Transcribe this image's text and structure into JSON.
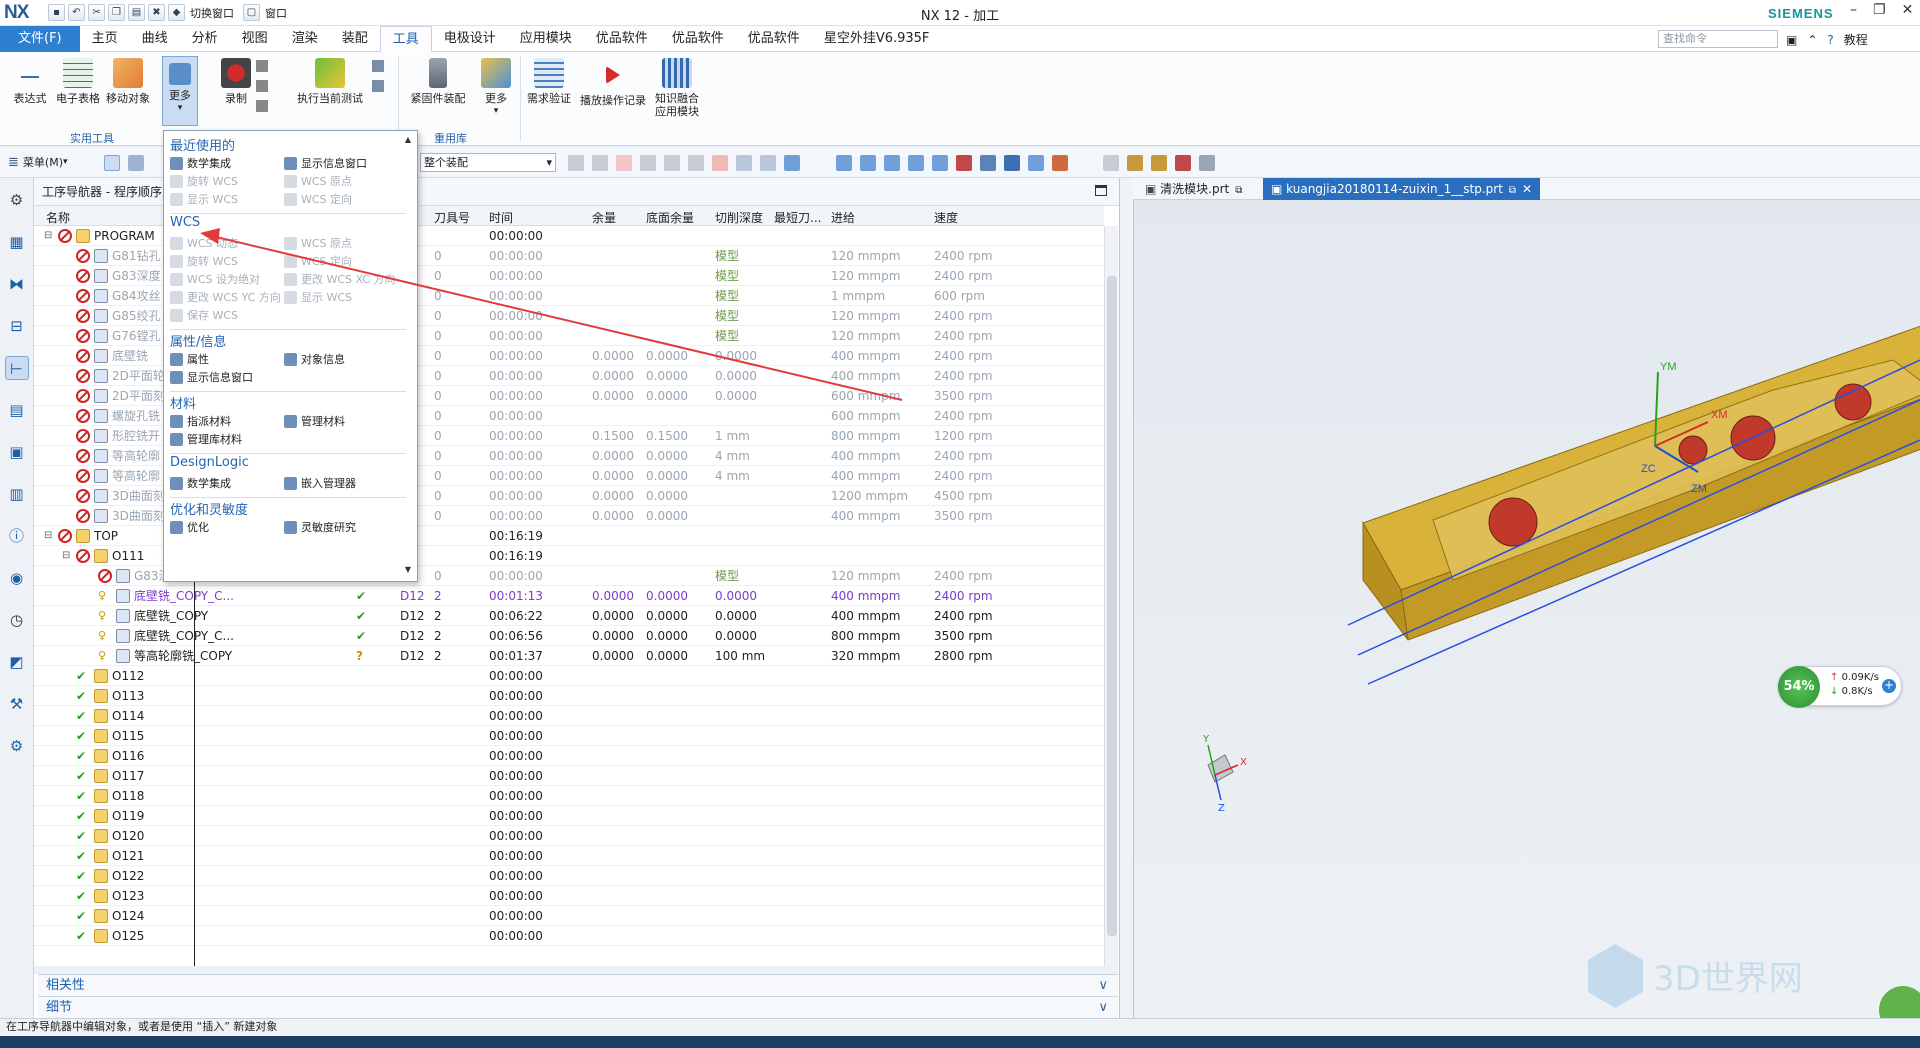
{
  "app": {
    "logo": "NX",
    "title": "NX 12 - 加工",
    "brand": "SIEMENS",
    "quick_access": [
      "切换窗口",
      "窗口"
    ]
  },
  "ribbon_tabs": [
    "文件(F)",
    "主页",
    "曲线",
    "分析",
    "视图",
    "渲染",
    "装配",
    "工具",
    "电极设计",
    "应用模块",
    "优品软件",
    "优品软件",
    "优品软件",
    "星空外挂V6.935F"
  ],
  "active_tab": "工具",
  "search_placeholder": "查找命令",
  "help_label": "教程",
  "ribbon": {
    "buttons": [
      "表达式",
      "电子表格",
      "移动对象",
      "更多",
      "录制",
      "执行当前测试",
      "紧固件装配",
      "更多",
      "需求验证",
      "播放操作记录",
      "知识融合应用模块"
    ],
    "groups": [
      "实用工具",
      "重用库"
    ]
  },
  "toolbar2": {
    "menu_label": "菜单(M)",
    "assembly_filter": "整个装配"
  },
  "navigator": {
    "title": "工序导航器 - 程序顺序",
    "columns": [
      "名称",
      "刀具号",
      "时间",
      "余量",
      "底面余量",
      "切削深度",
      "最短刀...",
      "进给",
      "速度"
    ],
    "rows": [
      {
        "name": "PROGRAM",
        "tool_no": "",
        "time": "00:00:00",
        "stock": "",
        "floor": "",
        "depth": "",
        "feed": "",
        "speed": "",
        "style": "",
        "level": 0
      },
      {
        "name": "G81钻孔",
        "tool_no": "0",
        "time": "00:00:00",
        "stock": "",
        "floor": "",
        "depth": "模型",
        "feed": "120 mmpm",
        "speed": "2400 rpm",
        "style": "gray",
        "level": 1
      },
      {
        "name": "G83深度",
        "tool_no": "0",
        "time": "00:00:00",
        "stock": "",
        "floor": "",
        "depth": "模型",
        "feed": "120 mmpm",
        "speed": "2400 rpm",
        "style": "gray",
        "level": 1
      },
      {
        "name": "G84攻丝",
        "tool_no": "0",
        "time": "00:00:00",
        "stock": "",
        "floor": "",
        "depth": "模型",
        "feed": "1 mmpm",
        "speed": "600 rpm",
        "style": "gray",
        "level": 1
      },
      {
        "name": "G85绞孔",
        "tool_no": "0",
        "time": "00:00:00",
        "stock": "",
        "floor": "",
        "depth": "模型",
        "feed": "120 mmpm",
        "speed": "2400 rpm",
        "style": "gray",
        "level": 1
      },
      {
        "name": "G76镗孔",
        "tool_no": "0",
        "time": "00:00:00",
        "stock": "",
        "floor": "",
        "depth": "模型",
        "feed": "120 mmpm",
        "speed": "2400 rpm",
        "style": "gray",
        "level": 1
      },
      {
        "name": "底壁铣",
        "tool_no": "0",
        "time": "00:00:00",
        "stock": "0.0000",
        "floor": "0.0000",
        "depth": "0.0000",
        "feed": "400 mmpm",
        "speed": "2400 rpm",
        "style": "gray",
        "level": 1
      },
      {
        "name": "2D平面轮",
        "tool_no": "0",
        "time": "00:00:00",
        "stock": "0.0000",
        "floor": "0.0000",
        "depth": "0.0000",
        "feed": "400 mmpm",
        "speed": "2400 rpm",
        "style": "gray",
        "level": 1
      },
      {
        "name": "2D平面刻",
        "tool_no": "0",
        "time": "00:00:00",
        "stock": "0.0000",
        "floor": "0.0000",
        "depth": "0.0000",
        "feed": "600 mmpm",
        "speed": "3500 rpm",
        "style": "gray",
        "level": 1
      },
      {
        "name": "螺旋孔铣",
        "tool_no": "0",
        "time": "00:00:00",
        "stock": "",
        "floor": "",
        "depth": "",
        "feed": "600 mmpm",
        "speed": "2400 rpm",
        "style": "gray",
        "level": 1
      },
      {
        "name": "形腔铣开",
        "tool_no": "0",
        "time": "00:00:00",
        "stock": "0.1500",
        "floor": "0.1500",
        "depth": "1 mm",
        "feed": "800 mmpm",
        "speed": "1200 rpm",
        "style": "gray",
        "level": 1
      },
      {
        "name": "等高轮廓",
        "tool_no": "0",
        "time": "00:00:00",
        "stock": "0.0000",
        "floor": "0.0000",
        "depth": "4 mm",
        "feed": "400 mmpm",
        "speed": "2400 rpm",
        "style": "gray",
        "level": 1
      },
      {
        "name": "等高轮廓",
        "tool_no": "0",
        "time": "00:00:00",
        "stock": "0.0000",
        "floor": "0.0000",
        "depth": "4 mm",
        "feed": "400 mmpm",
        "speed": "2400 rpm",
        "style": "gray",
        "level": 1
      },
      {
        "name": "3D曲面刻",
        "tool_no": "0",
        "time": "00:00:00",
        "stock": "0.0000",
        "floor": "0.0000",
        "depth": "",
        "feed": "1200 mmpm",
        "speed": "4500 rpm",
        "style": "gray",
        "level": 1
      },
      {
        "name": "3D曲面刻",
        "tool_no": "0",
        "time": "00:00:00",
        "stock": "0.0000",
        "floor": "0.0000",
        "depth": "",
        "feed": "400 mmpm",
        "speed": "3500 rpm",
        "style": "gray",
        "level": 1
      },
      {
        "name": "TOP",
        "tool_no": "",
        "time": "00:16:19",
        "stock": "",
        "floor": "",
        "depth": "",
        "feed": "",
        "speed": "",
        "style": "",
        "level": 0
      },
      {
        "name": "O111",
        "tool_no": "",
        "time": "00:16:19",
        "stock": "",
        "floor": "",
        "depth": "",
        "feed": "",
        "speed": "",
        "style": "",
        "level": 1
      },
      {
        "name": "G83深",
        "tool_no": "0",
        "time": "00:00:00",
        "stock": "",
        "floor": "",
        "depth": "模型",
        "feed": "120 mmpm",
        "speed": "2400 rpm",
        "style": "gray",
        "level": 2
      },
      {
        "name": "底壁铣_COPY_C...",
        "tool": "D12",
        "tool_no": "2",
        "time": "00:01:13",
        "stock": "0.0000",
        "floor": "0.0000",
        "depth": "0.0000",
        "feed": "400 mmpm",
        "speed": "2400 rpm",
        "style": "purple",
        "level": 2
      },
      {
        "name": "底壁铣_COPY",
        "tool": "D12",
        "tool_no": "2",
        "time": "00:06:22",
        "stock": "0.0000",
        "floor": "0.0000",
        "depth": "0.0000",
        "feed": "400 mmpm",
        "speed": "2400 rpm",
        "style": "",
        "level": 2
      },
      {
        "name": "底壁铣_COPY_C...",
        "tool": "D12",
        "tool_no": "2",
        "time": "00:06:56",
        "stock": "0.0000",
        "floor": "0.0000",
        "depth": "0.0000",
        "feed": "800 mmpm",
        "speed": "3500 rpm",
        "style": "",
        "level": 2
      },
      {
        "name": "等高轮廓铣_COPY",
        "tool": "D12",
        "tool_no": "2",
        "time": "00:01:37",
        "stock": "0.0000",
        "floor": "0.0000",
        "depth": "100 mm",
        "feed": "320 mmpm",
        "speed": "2800 rpm",
        "style": "",
        "level": 2
      },
      {
        "name": "O112",
        "tool_no": "",
        "time": "00:00:00",
        "style": "",
        "level": 1
      },
      {
        "name": "O113",
        "tool_no": "",
        "time": "00:00:00",
        "style": "",
        "level": 1
      },
      {
        "name": "O114",
        "tool_no": "",
        "time": "00:00:00",
        "style": "",
        "level": 1
      },
      {
        "name": "O115",
        "tool_no": "",
        "time": "00:00:00",
        "style": "",
        "level": 1
      },
      {
        "name": "O116",
        "tool_no": "",
        "time": "00:00:00",
        "style": "",
        "level": 1
      },
      {
        "name": "O117",
        "tool_no": "",
        "time": "00:00:00",
        "style": "",
        "level": 1
      },
      {
        "name": "O118",
        "tool_no": "",
        "time": "00:00:00",
        "style": "",
        "level": 1
      },
      {
        "name": "O119",
        "tool_no": "",
        "time": "00:00:00",
        "style": "",
        "level": 1
      },
      {
        "name": "O120",
        "tool_no": "",
        "time": "00:00:00",
        "style": "",
        "level": 1
      },
      {
        "name": "O121",
        "tool_no": "",
        "time": "00:00:00",
        "style": "",
        "level": 1
      },
      {
        "name": "O122",
        "tool_no": "",
        "time": "00:00:00",
        "style": "",
        "level": 1
      },
      {
        "name": "O123",
        "tool_no": "",
        "time": "00:00:00",
        "style": "",
        "level": 1
      },
      {
        "name": "O124",
        "tool_no": "",
        "time": "00:00:00",
        "style": "",
        "level": 1
      },
      {
        "name": "O125",
        "tool_no": "",
        "time": "00:00:00",
        "style": "",
        "level": 1
      }
    ],
    "panels": [
      "相关性",
      "细节"
    ]
  },
  "more_menu": {
    "sections": [
      {
        "title": "最近使用的",
        "items": [
          {
            "label": "数学集成",
            "enabled": true
          },
          {
            "label": "显示信息窗口",
            "enabled": true
          },
          {
            "label": "旋转 WCS",
            "enabled": false
          },
          {
            "label": "WCS 原点",
            "enabled": false
          },
          {
            "label": "显示 WCS",
            "enabled": false
          },
          {
            "label": "WCS 定向",
            "enabled": false
          }
        ]
      },
      {
        "title": "WCS",
        "items": [
          {
            "label": "WCS 动态",
            "enabled": false
          },
          {
            "label": "WCS 原点",
            "enabled": false
          },
          {
            "label": "旋转 WCS",
            "enabled": false
          },
          {
            "label": "WCS 定向",
            "enabled": false
          },
          {
            "label": "WCS 设为绝对",
            "enabled": false
          },
          {
            "label": "更改 WCS XC 方向",
            "enabled": false
          },
          {
            "label": "更改 WCS YC 方向",
            "enabled": false
          },
          {
            "label": "显示 WCS",
            "enabled": false
          },
          {
            "label": "保存 WCS",
            "enabled": false
          }
        ]
      },
      {
        "title": "属性/信息",
        "items": [
          {
            "label": "属性",
            "enabled": true
          },
          {
            "label": "对象信息",
            "enabled": true
          },
          {
            "label": "显示信息窗口",
            "enabled": true
          }
        ]
      },
      {
        "title": "材料",
        "items": [
          {
            "label": "指派材料",
            "enabled": true
          },
          {
            "label": "管理材料",
            "enabled": true
          },
          {
            "label": "管理库材料",
            "enabled": true
          }
        ]
      },
      {
        "title": "DesignLogic",
        "items": [
          {
            "label": "数学集成",
            "enabled": true
          },
          {
            "label": "嵌入管理器",
            "enabled": true
          }
        ]
      },
      {
        "title": "优化和灵敏度",
        "items": [
          {
            "label": "优化",
            "enabled": true
          },
          {
            "label": "灵敏度研究",
            "enabled": true
          }
        ]
      }
    ]
  },
  "graphics": {
    "tabs": [
      "清洗模块.prt",
      "kuangjia20180114-zuixin_1__stp.prt"
    ],
    "active_tab": 1,
    "axis_labels": [
      "YM",
      "ZC",
      "ZM",
      "XM"
    ],
    "triad": [
      "Y",
      "X",
      "Z"
    ],
    "network_widget": {
      "percent": "54%",
      "up": "0.09K/s",
      "down": "0.8K/s"
    },
    "watermark": "3D世界网"
  },
  "status_text": "在工序导航器中编辑对象，或者是使用 “插入” 新建对象",
  "colors": {
    "accent": "#2f7fd1",
    "arrow": "#e23b3b",
    "part": "#d9b23a",
    "toolpath": "#2a4ee0"
  }
}
